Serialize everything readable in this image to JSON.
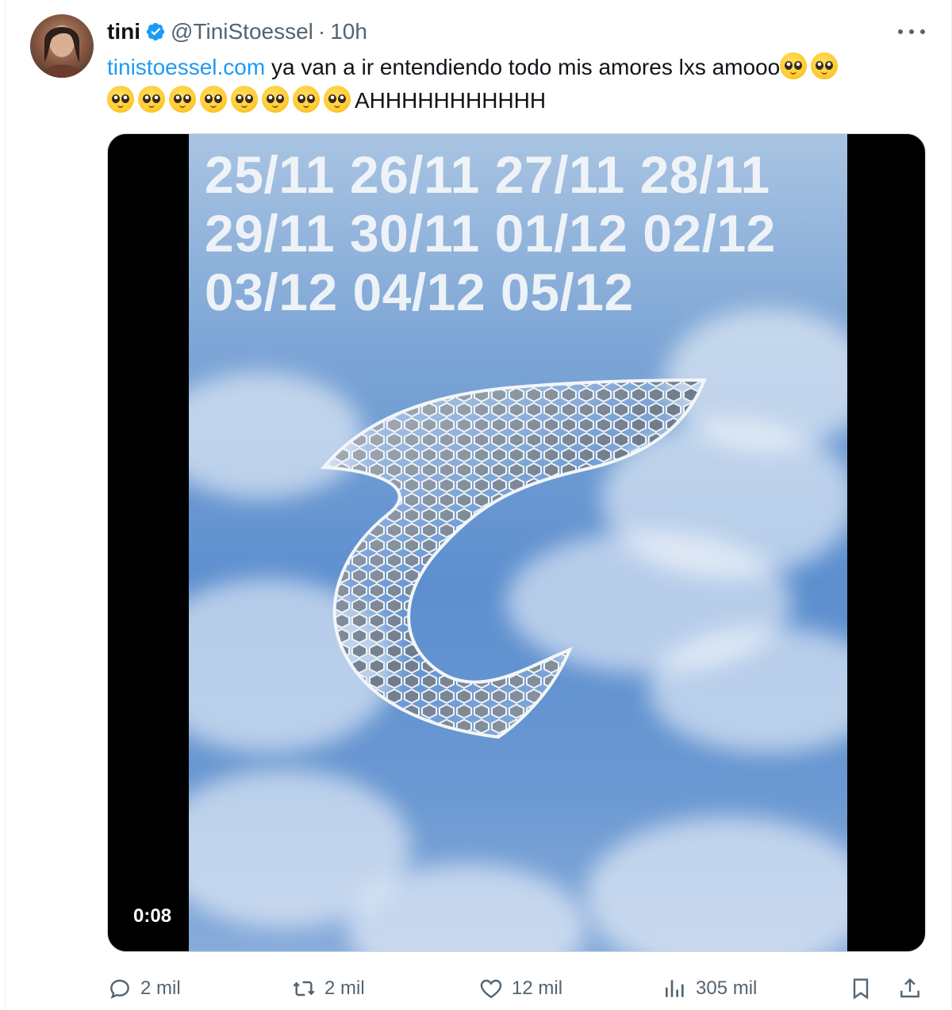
{
  "tweet": {
    "author_name": "tini",
    "author_handle": "@TiniStoessel",
    "separator": "·",
    "time": "10h",
    "verified": true,
    "text_link": "tinistoessel.com",
    "text_main": " ya van a ir entendiendo todo mis amores lxs amooo",
    "text_tail": "AHHHHHHHHHHH",
    "emoji_name": "pleading-face-emoji",
    "emoji_count_line1": 2,
    "emoji_count_line2": 8
  },
  "media": {
    "dates": [
      "25/11 26/11 27/11 28/11",
      "29/11 30/11 01/12 02/12",
      "03/12 04/12 05/12"
    ],
    "duration": "0:08"
  },
  "actions": {
    "replies": "2 mil",
    "reposts": "2 mil",
    "likes": "12 mil",
    "views": "305 mil"
  },
  "colors": {
    "link": "#1d9bf0",
    "secondary_text": "#536471",
    "primary_text": "#0f1419"
  },
  "icons": [
    "verified-badge-icon",
    "more-icon",
    "reply-icon",
    "repost-icon",
    "like-icon",
    "views-icon",
    "bookmark-icon",
    "share-icon"
  ]
}
